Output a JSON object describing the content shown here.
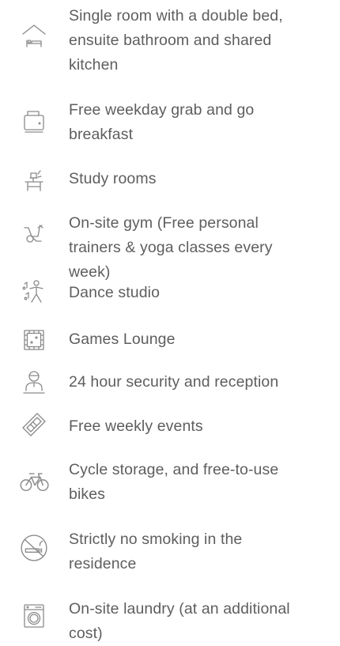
{
  "amenities": {
    "items": [
      {
        "icon": "house-bed-icon",
        "label": "Single room with a double bed, ensuite bathroom and shared kitchen"
      },
      {
        "icon": "toaster-icon",
        "label": "Free weekday grab and go breakfast"
      },
      {
        "icon": "desk-icon",
        "label": "Study rooms"
      },
      {
        "icon": "exercise-bike-icon",
        "label": "On-site gym (Free personal trainers & yoga classes every week)"
      },
      {
        "icon": "dancer-icon",
        "label": "Dance studio"
      },
      {
        "icon": "board-game-icon",
        "label": "Games Lounge"
      },
      {
        "icon": "security-person-icon",
        "label": "24 hour security and reception"
      },
      {
        "icon": "ticket-icon",
        "label": "Free weekly events"
      },
      {
        "icon": "bicycle-icon",
        "label": "Cycle storage, and free-to-use bikes"
      },
      {
        "icon": "no-smoking-icon",
        "label": "Strictly no smoking in the residence"
      },
      {
        "icon": "washing-machine-icon",
        "label": "On-site laundry (at an additional cost)"
      }
    ]
  }
}
